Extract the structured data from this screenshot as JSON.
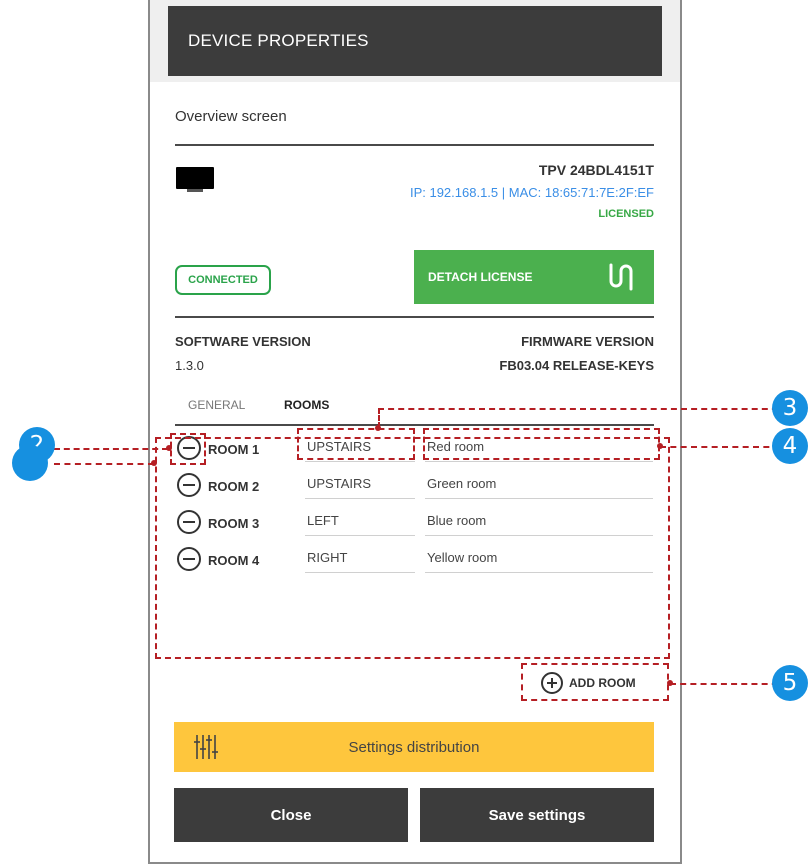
{
  "header": {
    "title": "DEVICE PROPERTIES"
  },
  "overview": {
    "title": "Overview screen"
  },
  "device": {
    "name": "TPV 24BDL4151T",
    "network": "IP: 192.168.1.5 | MAC: 18:65:71:7E:2F:EF",
    "license_status": "LICENSED",
    "connection_status": "CONNECTED",
    "detach_label": "DETACH LICENSE"
  },
  "versions": {
    "software_label": "SOFTWARE VERSION",
    "software_value": "1.3.0",
    "firmware_label": "FIRMWARE VERSION",
    "firmware_value": "FB03.04 RELEASE-KEYS"
  },
  "tabs": [
    {
      "label": "GENERAL",
      "active": false
    },
    {
      "label": "ROOMS",
      "active": true
    }
  ],
  "rooms": [
    {
      "label": "ROOM 1",
      "floor": "UPSTAIRS",
      "name": "Red room"
    },
    {
      "label": "ROOM 2",
      "floor": "UPSTAIRS",
      "name": "Green room"
    },
    {
      "label": "ROOM 3",
      "floor": "LEFT",
      "name": "Blue room"
    },
    {
      "label": "ROOM 4",
      "floor": "RIGHT",
      "name": "Yellow room"
    }
  ],
  "add_room_label": "ADD ROOM",
  "settings_distribution_label": "Settings distribution",
  "buttons": {
    "close": "Close",
    "save": "Save settings"
  },
  "callouts": [
    "2",
    "3",
    "4",
    "5",
    ""
  ],
  "colors": {
    "header_bg": "#3c3c3c",
    "accent_green": "#4bb04e",
    "link_blue": "#3a8ee6",
    "settings_yellow": "#fec63d",
    "annotation_red": "#b51f24",
    "callout_blue": "#1690e0"
  }
}
